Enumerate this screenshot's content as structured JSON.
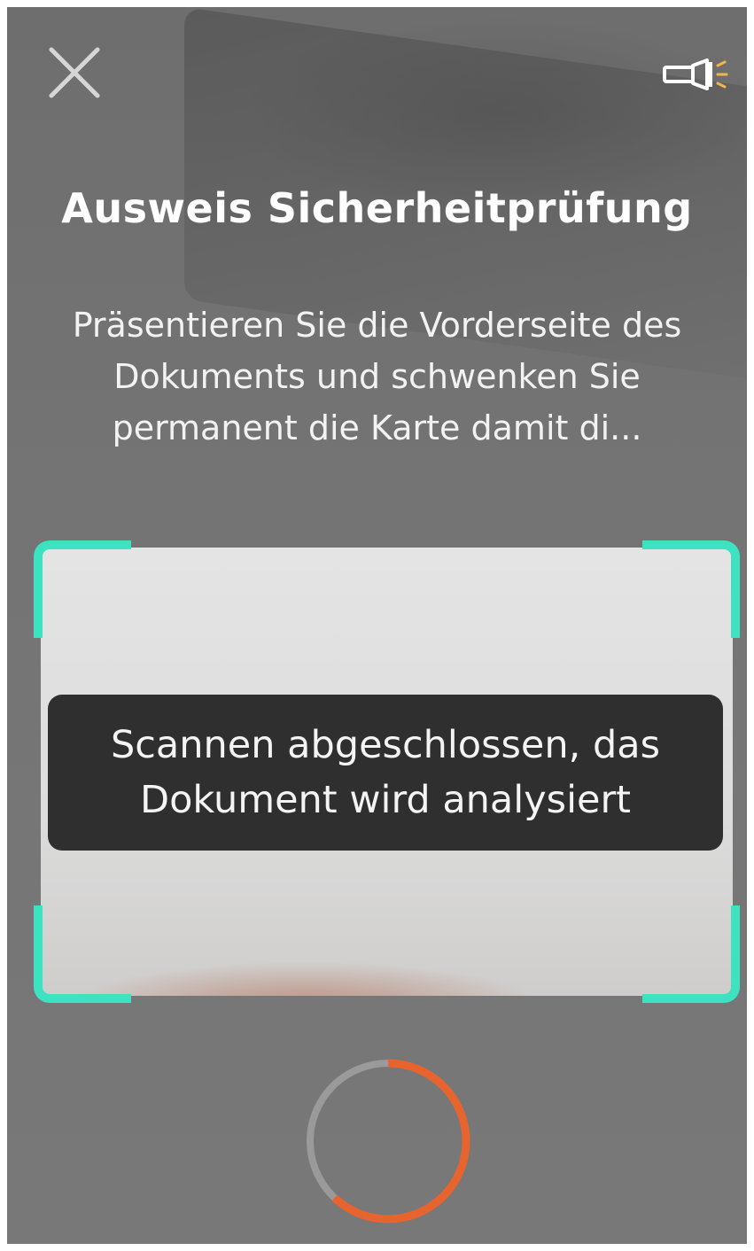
{
  "app": {
    "title": "Ausweis Sicherheitprüfung",
    "instructions": "Präsentieren Sie die Vorderseite des Dokuments und schwenken Sie permanent die Karte damit di..."
  },
  "toolbar": {
    "close_icon": "close-icon",
    "flashlight_icon": "flashlight-icon"
  },
  "scanner": {
    "status_message": "Scannen abgeschlossen, das Dokument wird analysiert",
    "progress_fraction": 0.62
  },
  "colors": {
    "frame_accent": "#3de2c1",
    "progress_accent": "#e8642f",
    "progress_track": "#9a9a9a",
    "toast_background": "#2f2f2f"
  }
}
